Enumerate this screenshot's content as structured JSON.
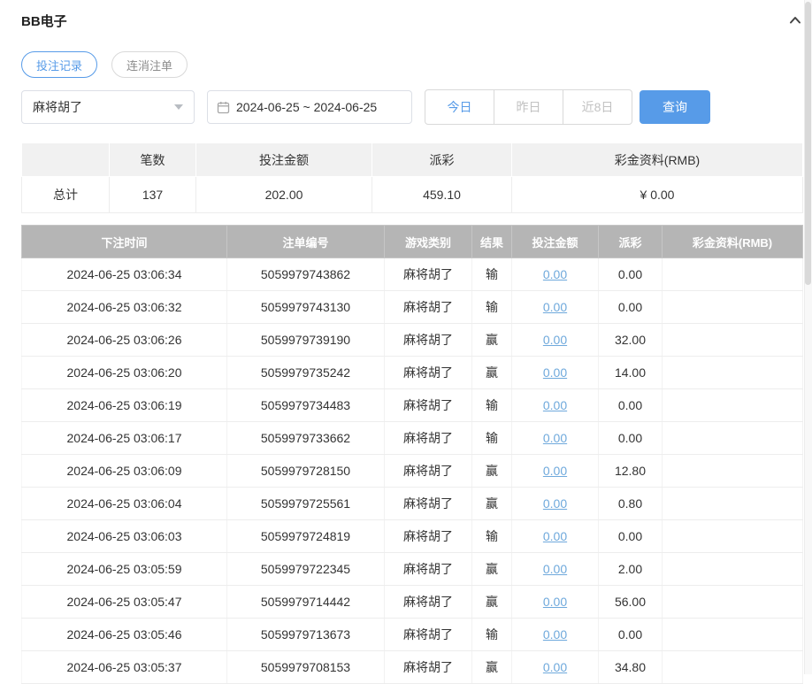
{
  "header": {
    "title": "BB电子"
  },
  "tabs": [
    {
      "label": "投注记录",
      "active": true
    },
    {
      "label": "连消注单",
      "active": false
    }
  ],
  "filters": {
    "game_select": {
      "value": "麻将胡了"
    },
    "date_range": {
      "value": "2024-06-25 ~ 2024-06-25"
    },
    "quick": [
      {
        "label": "今日",
        "active": true
      },
      {
        "label": "昨日",
        "active": false
      },
      {
        "label": "近8日",
        "active": false
      }
    ],
    "query_label": "查询"
  },
  "summary": {
    "headers": [
      "",
      "笔数",
      "投注金额",
      "派彩",
      "彩金资料(RMB)"
    ],
    "total": {
      "label": "总计",
      "count": "137",
      "bet_amount": "202.00",
      "payout": "459.10",
      "bonus": "¥ 0.00"
    }
  },
  "table": {
    "headers": [
      "下注时间",
      "注单编号",
      "游戏类别",
      "结果",
      "投注金额",
      "派彩",
      "彩金资料(RMB)"
    ],
    "rows": [
      [
        "2024-06-25 03:06:34",
        "5059979743862",
        "麻将胡了",
        "输",
        "0.00",
        "0.00",
        ""
      ],
      [
        "2024-06-25 03:06:32",
        "5059979743130",
        "麻将胡了",
        "输",
        "0.00",
        "0.00",
        ""
      ],
      [
        "2024-06-25 03:06:26",
        "5059979739190",
        "麻将胡了",
        "赢",
        "0.00",
        "32.00",
        ""
      ],
      [
        "2024-06-25 03:06:20",
        "5059979735242",
        "麻将胡了",
        "赢",
        "0.00",
        "14.00",
        ""
      ],
      [
        "2024-06-25 03:06:19",
        "5059979734483",
        "麻将胡了",
        "输",
        "0.00",
        "0.00",
        ""
      ],
      [
        "2024-06-25 03:06:17",
        "5059979733662",
        "麻将胡了",
        "输",
        "0.00",
        "0.00",
        ""
      ],
      [
        "2024-06-25 03:06:09",
        "5059979728150",
        "麻将胡了",
        "赢",
        "0.00",
        "12.80",
        ""
      ],
      [
        "2024-06-25 03:06:04",
        "5059979725561",
        "麻将胡了",
        "赢",
        "0.00",
        "0.80",
        ""
      ],
      [
        "2024-06-25 03:06:03",
        "5059979724819",
        "麻将胡了",
        "输",
        "0.00",
        "0.00",
        ""
      ],
      [
        "2024-06-25 03:05:59",
        "5059979722345",
        "麻将胡了",
        "赢",
        "0.00",
        "2.00",
        ""
      ],
      [
        "2024-06-25 03:05:47",
        "5059979714442",
        "麻将胡了",
        "赢",
        "0.00",
        "56.00",
        ""
      ],
      [
        "2024-06-25 03:05:46",
        "5059979713673",
        "麻将胡了",
        "输",
        "0.00",
        "0.00",
        ""
      ],
      [
        "2024-06-25 03:05:37",
        "5059979708153",
        "麻将胡了",
        "赢",
        "0.00",
        "34.80",
        ""
      ]
    ]
  },
  "colors": {
    "accent": "#579be8",
    "thead_bg": "#b5b5b5",
    "link": "#6fa9dc"
  }
}
